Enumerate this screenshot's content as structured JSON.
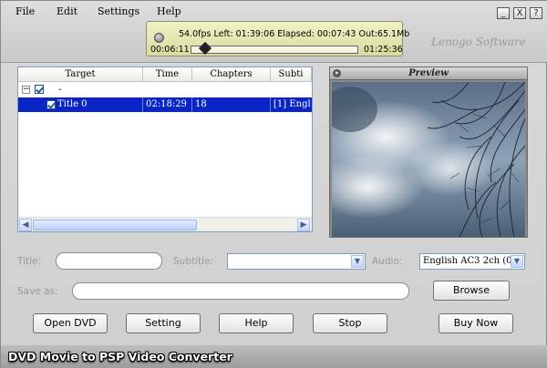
{
  "menu": {
    "file": "File",
    "edit": "Edit",
    "settings": "Settings",
    "help": "Help"
  },
  "window_controls": {
    "minimize": "_",
    "close": "X",
    "help": "?"
  },
  "status": {
    "line": "54.0fps Left: 01:39:06 Elapsed: 00:07:43 Out:65.1Mb",
    "elapsed": "00:06:11",
    "total": "01:25:36",
    "progress_fraction": 0.07
  },
  "brand": "Lenogo Software",
  "table": {
    "columns": [
      "Target",
      "Time",
      "Chapters",
      "Subti"
    ],
    "root_row": {
      "toggle": "−",
      "target": "-"
    },
    "rows": [
      {
        "target": "Title 0",
        "time": "02:18:29",
        "chapters": "18",
        "subtitle": "[1] Engl"
      }
    ]
  },
  "preview": {
    "title": "Preview"
  },
  "form": {
    "title_label": "Title:",
    "title_value": "",
    "subtitle_label": "Subtitle:",
    "subtitle_value": "",
    "audio_label": "Audio:",
    "audio_value": "English AC3 2ch (0:",
    "save_as_label": "Save as:",
    "save_as_value": ""
  },
  "buttons": {
    "browse": "Browse",
    "open_dvd": "Open DVD",
    "setting": "Setting",
    "help": "Help",
    "stop": "Stop",
    "buy_now": "Buy Now"
  },
  "app_title": "DVD Movie to PSP Video Converter"
}
